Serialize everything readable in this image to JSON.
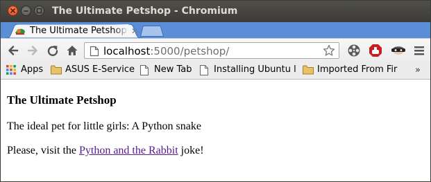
{
  "window": {
    "title": "The Ultimate Petshop - Chromium"
  },
  "tabs": [
    {
      "label": "The Ultimate Petshop",
      "active": true,
      "favicon": "pet-favicon-icon"
    }
  ],
  "toolbar": {
    "back_icon": "back-arrow-icon",
    "forward_icon": "forward-arrow-icon",
    "reload_icon": "reload-icon",
    "home_icon": "home-icon",
    "url_host": "localhost",
    "url_rest": ":5000/petshop/",
    "extensions": [
      "film-reel-icon",
      "stop-sign-icon",
      "masked-bandit-icon"
    ],
    "menu_icon": "hamburger-menu-icon"
  },
  "bookmarks": {
    "items": [
      {
        "label": "Apps",
        "icon": "apps-grid-icon"
      },
      {
        "label": "ASUS E-Service",
        "icon": "folder-icon"
      },
      {
        "label": "New Tab",
        "icon": "page-icon"
      },
      {
        "label": "Installing Ubuntu l",
        "icon": "page-icon"
      },
      {
        "label": "Imported From Fir",
        "icon": "folder-icon"
      }
    ],
    "overflow": "»"
  },
  "page": {
    "heading": "The Ultimate Petshop",
    "line1": "The ideal pet for little girls: A Python snake",
    "line2_prefix": "Please, visit the ",
    "link_text": "Python and the Rabbit",
    "line2_suffix": " joke!"
  },
  "colors": {
    "tabstrip": "#5a8fd7",
    "link_visited": "#551a8b",
    "close_button": "#e0491f"
  }
}
